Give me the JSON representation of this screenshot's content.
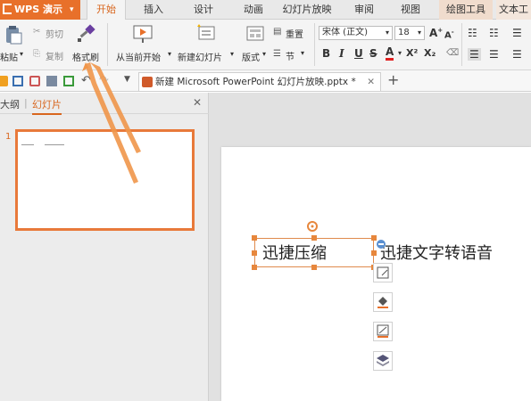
{
  "app": {
    "name": "WPS 演示"
  },
  "tabs": [
    "开始",
    "插入",
    "设计",
    "动画",
    "幻灯片放映",
    "审阅",
    "视图",
    "绘图工具",
    "文本工"
  ],
  "ribbon": {
    "paste": "粘贴",
    "cut": "剪切",
    "copy": "复制",
    "format_painter": "格式刷",
    "from_current": "从当前开始",
    "new_slide": "新建幻灯片",
    "layout": "版式",
    "reset": "重置",
    "section": "节",
    "font_name": "宋体 (正文)",
    "font_size": "18",
    "bold": "B",
    "italic": "I",
    "underline": "U",
    "strike": "S",
    "font_color": "A",
    "superscript": "X²",
    "subscript": "X₂"
  },
  "document": {
    "tab_title": "新建 Microsoft PowerPoint 幻灯片放映.pptx *"
  },
  "left_panel": {
    "outline_tab": "大纲",
    "slides_tab": "幻灯片",
    "slide_number": "1"
  },
  "slide": {
    "textbox1": "迅捷压缩",
    "textbox2": "迅捷文字转语音"
  },
  "colors": {
    "accent": "#e8702a",
    "annotation_arrow": "#f0964a"
  }
}
